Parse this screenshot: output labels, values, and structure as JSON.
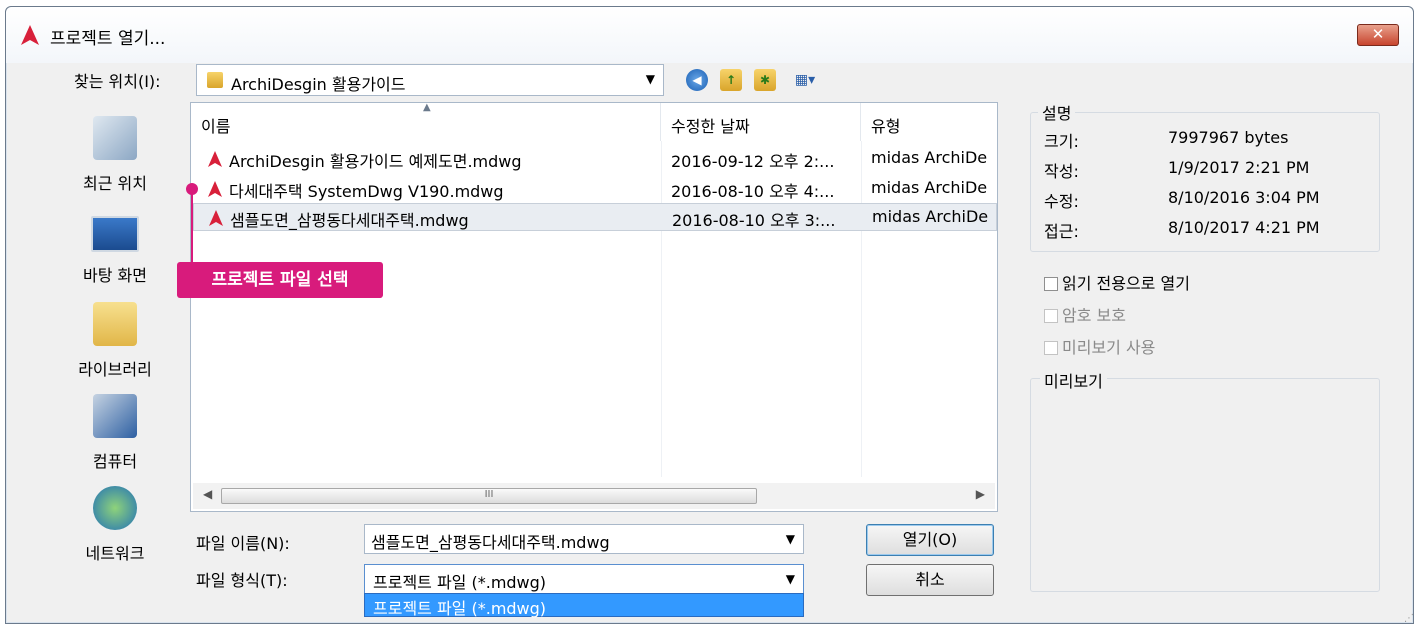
{
  "window": {
    "title": "프로젝트 열기...",
    "close_label": "✕"
  },
  "look_in": {
    "label": "찾는 위치(I):",
    "value": "ArchiDesgin 활용가이드"
  },
  "toolbar": [
    "back-icon",
    "up-folder-icon",
    "new-folder-icon",
    "view-menu-icon"
  ],
  "places": [
    {
      "label": "최근 위치",
      "icon": "recent-places-icon"
    },
    {
      "label": "바탕 화면",
      "icon": "desktop-icon"
    },
    {
      "label": "라이브러리",
      "icon": "libraries-icon"
    },
    {
      "label": "컴퓨터",
      "icon": "computer-icon"
    },
    {
      "label": "네트워크",
      "icon": "network-icon"
    }
  ],
  "file_list": {
    "columns": [
      "이름",
      "수정한 날짜",
      "유형"
    ],
    "files": [
      {
        "name": "ArchiDesgin 활용가이드 예제도면.mdwg",
        "modified": "2016-09-12 오후 2:...",
        "type": "midas ArchiDe"
      },
      {
        "name": "다세대주택 SystemDwg V190.mdwg",
        "modified": "2016-08-10 오후 4:...",
        "type": "midas ArchiDe"
      },
      {
        "name": "샘플도면_삼평동다세대주택.mdwg",
        "modified": "2016-08-10 오후 3:...",
        "type": "midas ArchiDe"
      }
    ],
    "scroll_thumb_label": "III"
  },
  "callout": {
    "text": "프로젝트 파일 선택",
    "color": "#d81b7c"
  },
  "file_name": {
    "label": "파일 이름(N):",
    "value": "샘플도면_삼평동다세대주택.mdwg"
  },
  "file_type": {
    "label": "파일 형식(T):",
    "value": "프로젝트 파일 (*.mdwg)",
    "options": [
      "프로젝트 파일 (*.mdwg)"
    ]
  },
  "buttons": {
    "open": "열기(O)",
    "cancel": "취소"
  },
  "info": {
    "legend": "설명",
    "rows": [
      {
        "label": "크기:",
        "value": "7997967 bytes"
      },
      {
        "label": "작성:",
        "value": "1/9/2017 2:21 PM"
      },
      {
        "label": "수정:",
        "value": "8/10/2016 3:04 PM"
      },
      {
        "label": "접근:",
        "value": "8/10/2017 4:21 PM"
      }
    ]
  },
  "options": {
    "read_only": "읽기 전용으로 열기",
    "password": "암호 보호",
    "preview": "미리보기 사용"
  },
  "preview": {
    "legend": "미리보기"
  }
}
